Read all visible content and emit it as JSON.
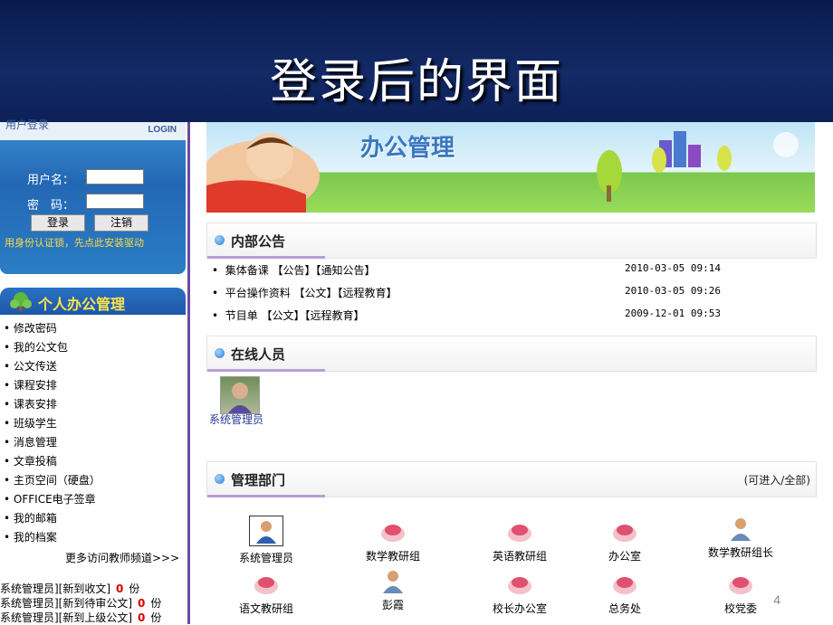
{
  "slide": {
    "title": "登录后的界面",
    "page_number": "4"
  },
  "login": {
    "header_label": "用户登录",
    "header_tag": "LOGIN",
    "username_label": "用户名：",
    "password_label": "密　码：",
    "login_button": "登录",
    "logout_button": "注销",
    "note": "用身份认证锁，先点此安装驱动"
  },
  "personal": {
    "title": "个人办公管理",
    "items": [
      "修改密码",
      "我的公文包",
      "公文传送",
      "课程安排",
      "课表安排",
      "班级学生",
      "消息管理",
      "文章投稿",
      "主页空间（硬盘）",
      "OFFICE电子签章",
      "我的邮箱",
      "我的档案"
    ],
    "more_link": "更多访问教师频道>>>"
  },
  "stats": [
    {
      "label": "系统管理员][新到收文]",
      "count": "0",
      "unit": "份"
    },
    {
      "label": "系统管理员][新到待审公文]",
      "count": "0",
      "unit": "份"
    },
    {
      "label": "系统管理员][新到上级公文]",
      "count": "0",
      "unit": "份"
    }
  ],
  "banner": {
    "title": "办公管理"
  },
  "notices": {
    "title": "内部公告",
    "items": [
      {
        "text": "集体备课 【公告】【通知公告】",
        "date": "2010-03-05 09:14"
      },
      {
        "text": "平台操作资料 【公文】【远程教育】",
        "date": "2010-03-05 09:26"
      },
      {
        "text": "节目单 【公文】【远程教育】",
        "date": "2009-12-01 09:53"
      }
    ]
  },
  "online": {
    "title": "在线人员",
    "users": [
      "系统管理员"
    ]
  },
  "departments": {
    "title": "管理部门",
    "hint": "(可进入/全部)",
    "items": [
      "系统管理员",
      "数学教研组",
      "英语教研组",
      "办公室",
      "数学教研组长",
      "语文教研组",
      "彭霞",
      "校长办公室",
      "总务处",
      "校党委"
    ]
  },
  "colors": {
    "title_bg": "#0d2058",
    "login_bg": "#2367b4",
    "menu_header": "#1e58a8",
    "accent_yellow": "#ffe44a",
    "count_red": "#dd0000"
  }
}
